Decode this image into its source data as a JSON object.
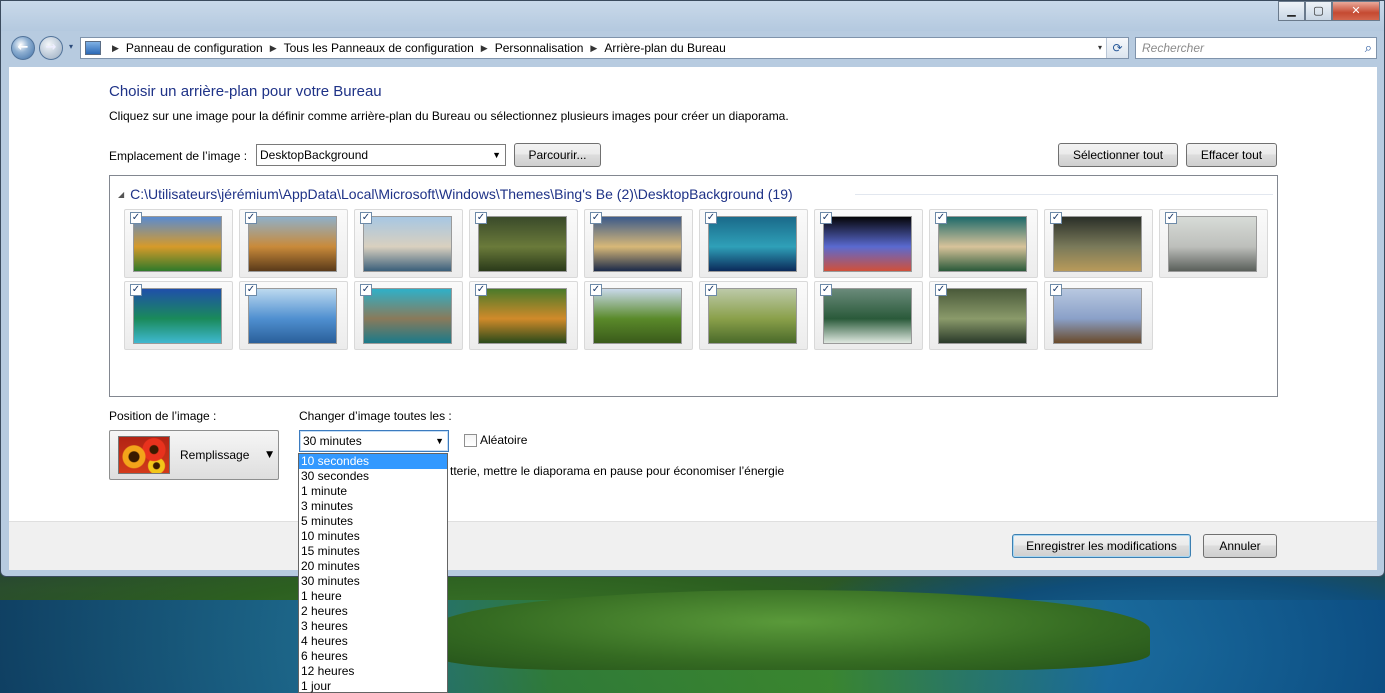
{
  "window": {
    "controls": {
      "minimize": "▁",
      "maximize": "▢",
      "close": "✕"
    }
  },
  "nav": {
    "back_glyph": "←",
    "forward_glyph": "→",
    "dropdown_glyph": "▾",
    "breadcrumb": [
      "Panneau de configuration",
      "Tous les Panneaux de configuration",
      "Personnalisation",
      "Arrière-plan du Bureau"
    ],
    "separator": "▶",
    "refresh_glyph": "⟳",
    "search_placeholder": "Rechercher",
    "search_glyph": "⌕"
  },
  "main": {
    "title": "Choisir un arrière-plan pour votre Bureau",
    "subtitle": "Cliquez sur une image pour la définir comme arrière-plan du Bureau ou sélectionnez plusieurs images pour créer un diaporama.",
    "location_label": "Emplacement de l’image :",
    "location_value": "DesktopBackground",
    "browse_button": "Parcourir...",
    "select_all_button": "Sélectionner tout",
    "clear_all_button": "Effacer tout",
    "group": {
      "collapse_glyph": "◢",
      "path": "C:\\Utilisateurs\\jérémium\\AppData\\Local\\Microsoft\\Windows\\Themes\\Bing's Be (2)\\DesktopBackground (19)"
    },
    "thumbnails": [
      {
        "icon": "thumbnail-hills",
        "checked": true,
        "colors": [
          "#5a8bd0",
          "#d69a2a",
          "#2f7a2a"
        ]
      },
      {
        "icon": "thumbnail-easter-island",
        "checked": true,
        "colors": [
          "#8fb0c9",
          "#c98a3a",
          "#5a3a1a"
        ]
      },
      {
        "icon": "thumbnail-chateau",
        "checked": true,
        "colors": [
          "#a7c7e3",
          "#d9d0bf",
          "#3a5f7a"
        ]
      },
      {
        "icon": "thumbnail-bird",
        "checked": true,
        "colors": [
          "#3a4a2a",
          "#6a7a3a",
          "#2a3a1a"
        ]
      },
      {
        "icon": "thumbnail-bridge",
        "checked": true,
        "colors": [
          "#3b5a8a",
          "#d7b878",
          "#1b2a4a"
        ]
      },
      {
        "icon": "thumbnail-blue-hole",
        "checked": true,
        "colors": [
          "#1a6a8a",
          "#2fa0b8",
          "#0b2a5a"
        ]
      },
      {
        "icon": "thumbnail-nebula",
        "checked": true,
        "colors": [
          "#050508",
          "#5a6ad0",
          "#d0503a"
        ]
      },
      {
        "icon": "thumbnail-coast",
        "checked": true,
        "colors": [
          "#1d6a6a",
          "#d7c39a",
          "#2a5a3a"
        ]
      },
      {
        "icon": "thumbnail-storm",
        "checked": true,
        "colors": [
          "#2a2f28",
          "#7a7a5a",
          "#b89a5a"
        ]
      },
      {
        "icon": "thumbnail-turtle",
        "checked": true,
        "colors": [
          "#d7dbd7",
          "#bdbfbb",
          "#5a5f5a"
        ]
      },
      {
        "icon": "thumbnail-lagoon",
        "checked": true,
        "colors": [
          "#1f4faa",
          "#1a8a5a",
          "#3fb8d0"
        ]
      },
      {
        "icon": "thumbnail-ice",
        "checked": true,
        "colors": [
          "#bcd9ef",
          "#4f8fd0",
          "#2a5f9a"
        ]
      },
      {
        "icon": "thumbnail-fort",
        "checked": true,
        "colors": [
          "#2fb0c8",
          "#8a7a5a",
          "#1a7a8a"
        ]
      },
      {
        "icon": "thumbnail-tiger",
        "checked": true,
        "colors": [
          "#4a7a2a",
          "#d08a2a",
          "#2a4a1a"
        ]
      },
      {
        "icon": "thumbnail-savanna",
        "checked": true,
        "colors": [
          "#c9d9ea",
          "#5a8a2a",
          "#3a5a1a"
        ]
      },
      {
        "icon": "thumbnail-fields",
        "checked": true,
        "colors": [
          "#bcc9a8",
          "#8aa04a",
          "#4a6a2a"
        ]
      },
      {
        "icon": "thumbnail-falls",
        "checked": true,
        "colors": [
          "#6a8a7a",
          "#2a5a3a",
          "#dfe8e0"
        ]
      },
      {
        "icon": "thumbnail-valley",
        "checked": true,
        "colors": [
          "#4a5a3a",
          "#8a9a6a",
          "#2a3a2a"
        ]
      },
      {
        "icon": "thumbnail-otter",
        "checked": true,
        "colors": [
          "#b8c8e0",
          "#8aa0c8",
          "#6a4a2a"
        ]
      }
    ],
    "position_label": "Position de l’image :",
    "position_value": "Remplissage",
    "interval_label": "Changer d’image toutes les :",
    "interval_value": "30 minutes",
    "shuffle_label": "Aléatoire",
    "battery_text": "tterie, mettre le diaporama en pause pour économiser l’énergie",
    "interval_options": [
      "10 secondes",
      "30 secondes",
      "1 minute",
      "3 minutes",
      "5 minutes",
      "10 minutes",
      "15 minutes",
      "20 minutes",
      "30 minutes",
      "1 heure",
      "2 heures",
      "3 heures",
      "4 heures",
      "6 heures",
      "12 heures",
      "1 jour"
    ],
    "highlighted_option_index": 0
  },
  "footer": {
    "save_button": "Enregistrer les modifications",
    "cancel_button": "Annuler"
  },
  "colors": {
    "title_blue": "#1e3287",
    "selection_blue": "#3399ff",
    "window_frame": "#b7cbe0"
  }
}
